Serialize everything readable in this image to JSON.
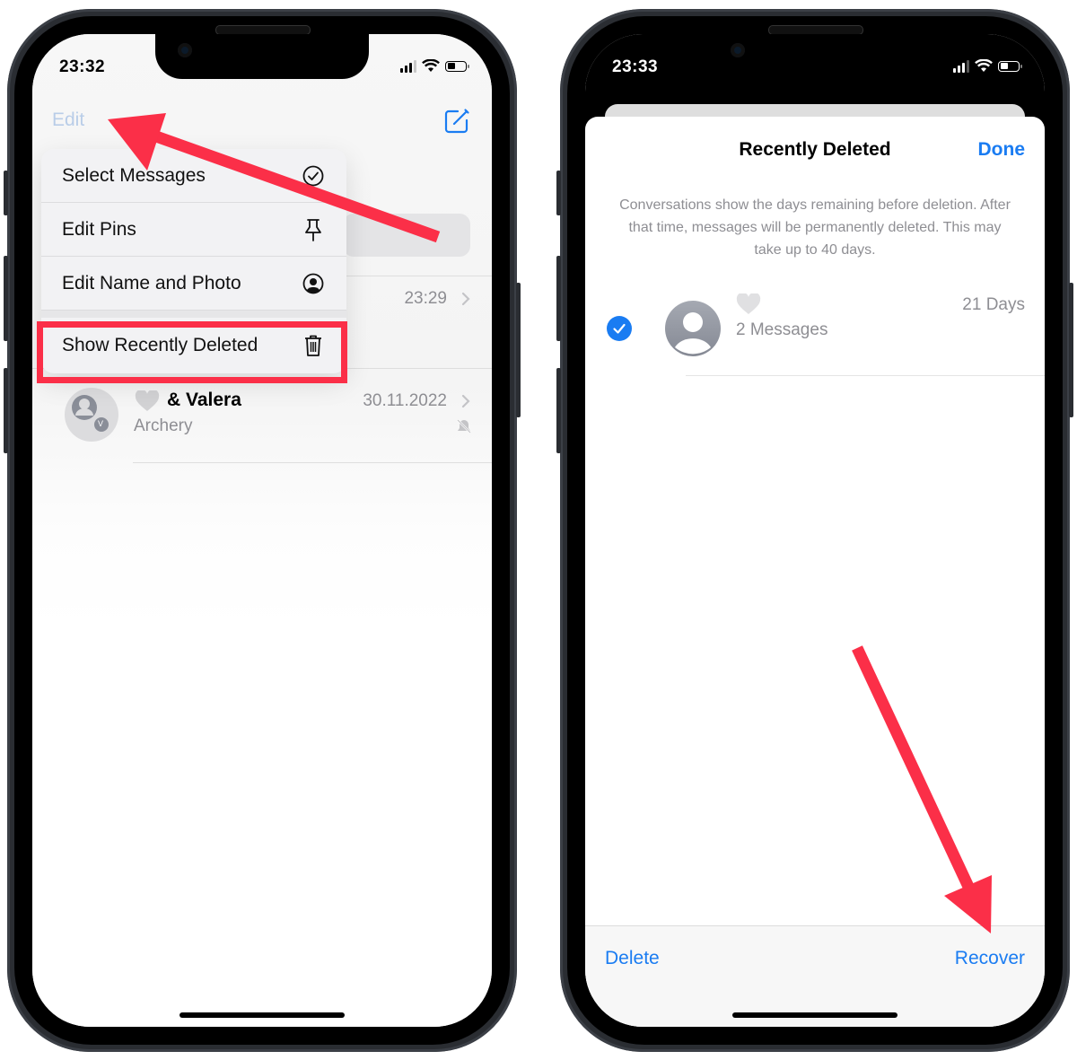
{
  "left_phone": {
    "status": {
      "time": "23:32"
    },
    "nav": {
      "edit_label": "Edit",
      "compose_icon": "compose-icon"
    },
    "menu": {
      "items": [
        {
          "label": "Select Messages",
          "icon": "checkmark-circle-icon"
        },
        {
          "label": "Edit Pins",
          "icon": "pin-icon"
        },
        {
          "label": "Edit Name and Photo",
          "icon": "person-circle-icon"
        },
        {
          "label": "Show Recently Deleted",
          "icon": "trash-icon",
          "highlighted": true
        }
      ]
    },
    "conversations": [
      {
        "time": "23:29"
      },
      {
        "name": "& Valera",
        "subtitle": "Archery",
        "date": "30.11.2022",
        "avatar_initial": "V",
        "muted": true
      }
    ]
  },
  "right_phone": {
    "status": {
      "time": "23:33"
    },
    "sheet": {
      "title": "Recently Deleted",
      "done_label": "Done",
      "info": "Conversations show the days remaining before deletion. After that time, messages will be permanently deleted. This may take up to 40 days."
    },
    "deleted_items": [
      {
        "subtitle": "2 Messages",
        "days_remaining": "21 Days",
        "selected": true
      }
    ],
    "toolbar": {
      "delete_label": "Delete",
      "recover_label": "Recover"
    }
  },
  "colors": {
    "accent": "#1a7cf2",
    "annotation": "#fb2f48",
    "secondary_text": "#8e8e93"
  }
}
